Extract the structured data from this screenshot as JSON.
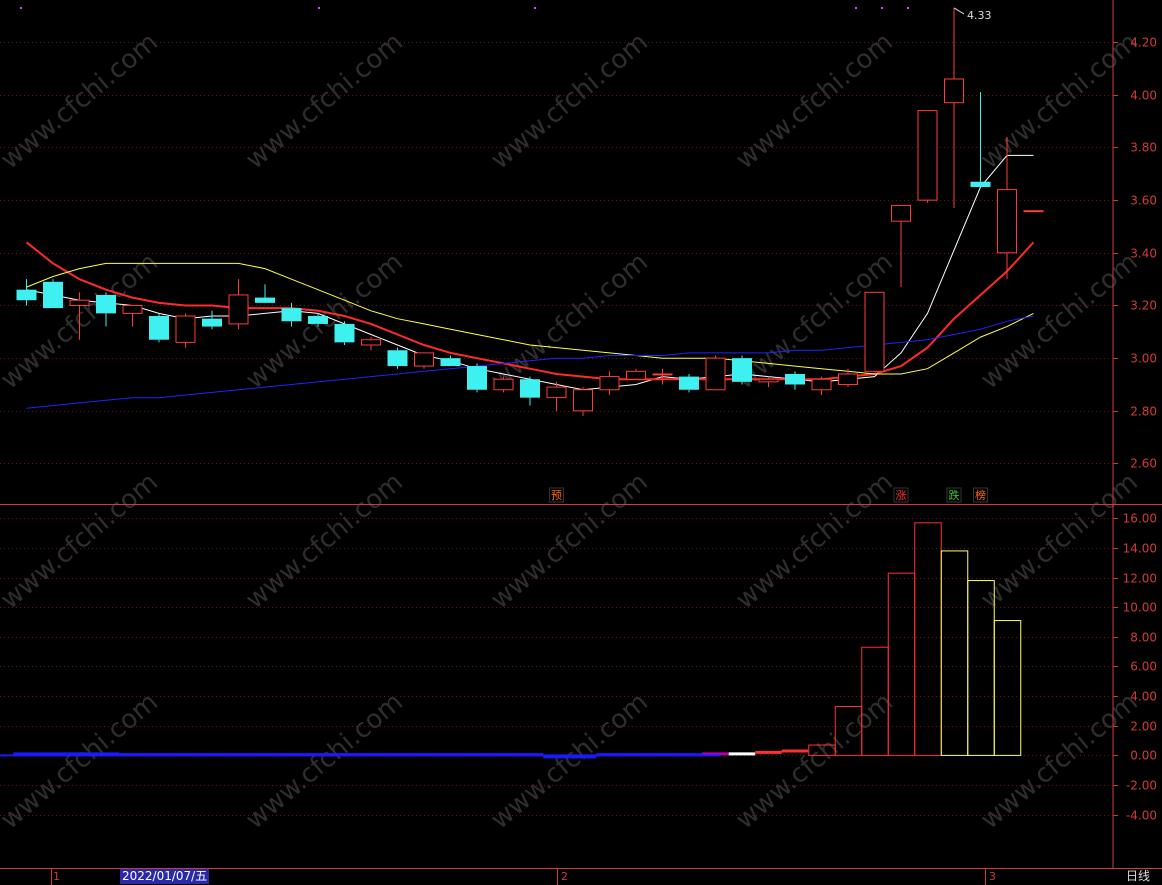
{
  "chart_data": [
    {
      "type": "candlestick",
      "panel": "price",
      "yticks": [
        "4.20",
        "4.00",
        "3.80",
        "3.60",
        "3.40",
        "3.20",
        "3.00",
        "2.80",
        "2.60"
      ],
      "ylim": [
        2.45,
        4.36
      ],
      "grid": true,
      "high_label": "4.33",
      "candles": [
        {
          "o": 3.26,
          "h": 3.3,
          "l": 3.2,
          "c": 3.22
        },
        {
          "o": 3.29,
          "h": 3.3,
          "l": 3.19,
          "c": 3.19
        },
        {
          "o": 3.2,
          "h": 3.25,
          "l": 3.07,
          "c": 3.22
        },
        {
          "o": 3.24,
          "h": 3.25,
          "l": 3.12,
          "c": 3.17
        },
        {
          "o": 3.17,
          "h": 3.2,
          "l": 3.12,
          "c": 3.2
        },
        {
          "o": 3.16,
          "h": 3.17,
          "l": 3.06,
          "c": 3.07
        },
        {
          "o": 3.06,
          "h": 3.17,
          "l": 3.04,
          "c": 3.16
        },
        {
          "o": 3.15,
          "h": 3.18,
          "l": 3.11,
          "c": 3.12
        },
        {
          "o": 3.13,
          "h": 3.3,
          "l": 3.11,
          "c": 3.24
        },
        {
          "o": 3.23,
          "h": 3.28,
          "l": 3.21,
          "c": 3.21
        },
        {
          "o": 3.19,
          "h": 3.21,
          "l": 3.12,
          "c": 3.14
        },
        {
          "o": 3.16,
          "h": 3.17,
          "l": 3.12,
          "c": 3.13
        },
        {
          "o": 3.13,
          "h": 3.14,
          "l": 3.05,
          "c": 3.06
        },
        {
          "o": 3.05,
          "h": 3.08,
          "l": 3.03,
          "c": 3.07
        },
        {
          "o": 3.03,
          "h": 3.04,
          "l": 2.96,
          "c": 2.97
        },
        {
          "o": 2.97,
          "h": 3.02,
          "l": 2.96,
          "c": 3.02
        },
        {
          "o": 3.0,
          "h": 3.01,
          "l": 2.97,
          "c": 2.97
        },
        {
          "o": 2.97,
          "h": 2.98,
          "l": 2.87,
          "c": 2.88
        },
        {
          "o": 2.88,
          "h": 2.93,
          "l": 2.87,
          "c": 2.92
        },
        {
          "o": 2.92,
          "h": 2.93,
          "l": 2.82,
          "c": 2.85
        },
        {
          "o": 2.85,
          "h": 2.91,
          "l": 2.8,
          "c": 2.89
        },
        {
          "o": 2.8,
          "h": 2.89,
          "l": 2.78,
          "c": 2.88
        },
        {
          "o": 2.88,
          "h": 2.95,
          "l": 2.86,
          "c": 2.93
        },
        {
          "o": 2.92,
          "h": 2.96,
          "l": 2.92,
          "c": 2.95
        },
        {
          "o": 2.94,
          "h": 2.96,
          "l": 2.9,
          "c": 2.94
        },
        {
          "o": 2.93,
          "h": 2.94,
          "l": 2.87,
          "c": 2.88
        },
        {
          "o": 2.88,
          "h": 3.01,
          "l": 2.88,
          "c": 3.0
        },
        {
          "o": 3.0,
          "h": 3.01,
          "l": 2.9,
          "c": 2.91
        },
        {
          "o": 2.91,
          "h": 2.93,
          "l": 2.89,
          "c": 2.92
        },
        {
          "o": 2.94,
          "h": 2.95,
          "l": 2.88,
          "c": 2.9
        },
        {
          "o": 2.88,
          "h": 2.93,
          "l": 2.86,
          "c": 2.92
        },
        {
          "o": 2.9,
          "h": 2.96,
          "l": 2.89,
          "c": 2.94
        },
        {
          "o": 2.95,
          "h": 3.25,
          "l": 2.95,
          "c": 3.25
        },
        {
          "o": 3.52,
          "h": 3.58,
          "l": 3.27,
          "c": 3.58
        },
        {
          "o": 3.6,
          "h": 3.94,
          "l": 3.59,
          "c": 3.94
        },
        {
          "o": 3.97,
          "h": 4.33,
          "l": 3.57,
          "c": 4.06
        },
        {
          "o": 3.67,
          "h": 4.01,
          "l": 3.65,
          "c": 3.65
        },
        {
          "o": 3.4,
          "h": 3.84,
          "l": 3.3,
          "c": 3.64
        },
        {
          "o": 3.56,
          "h": 3.56,
          "l": 3.56,
          "c": 3.56
        }
      ],
      "series": [
        {
          "color": "#ffffff",
          "values": [
            3.26,
            3.24,
            3.22,
            3.21,
            3.2,
            3.17,
            3.15,
            3.16,
            3.16,
            3.17,
            3.18,
            3.17,
            3.13,
            3.09,
            3.05,
            3.01,
            2.99,
            2.96,
            2.94,
            2.92,
            2.9,
            2.88,
            2.89,
            2.9,
            2.93,
            2.92,
            2.93,
            2.94,
            2.93,
            2.92,
            2.91,
            2.92,
            2.93,
            3.02,
            3.17,
            3.41,
            3.65,
            3.77,
            3.77
          ]
        },
        {
          "color": "#ff2a2a",
          "values": [
            3.44,
            3.36,
            3.3,
            3.26,
            3.23,
            3.21,
            3.2,
            3.2,
            3.19,
            3.19,
            3.19,
            3.18,
            3.16,
            3.13,
            3.09,
            3.05,
            3.02,
            3.0,
            2.98,
            2.96,
            2.94,
            2.93,
            2.92,
            2.92,
            2.92,
            2.92,
            2.92,
            2.92,
            2.92,
            2.92,
            2.92,
            2.93,
            2.94,
            2.97,
            3.04,
            3.15,
            3.24,
            3.33,
            3.44
          ]
        },
        {
          "color": "#ffff40",
          "values": [
            3.27,
            3.31,
            3.34,
            3.36,
            3.36,
            3.36,
            3.36,
            3.36,
            3.36,
            3.34,
            3.3,
            3.26,
            3.22,
            3.18,
            3.15,
            3.13,
            3.11,
            3.09,
            3.07,
            3.05,
            3.04,
            3.03,
            3.02,
            3.01,
            3.0,
            3.0,
            3.0,
            2.99,
            2.98,
            2.97,
            2.96,
            2.95,
            2.94,
            2.94,
            2.96,
            3.02,
            3.08,
            3.12,
            3.17
          ]
        },
        {
          "color": "#2222ff",
          "values": [
            2.81,
            2.82,
            2.83,
            2.84,
            2.85,
            2.85,
            2.86,
            2.87,
            2.88,
            2.89,
            2.9,
            2.91,
            2.92,
            2.93,
            2.94,
            2.95,
            2.96,
            2.97,
            2.98,
            2.99,
            3.0,
            3.0,
            3.01,
            3.01,
            3.01,
            3.02,
            3.02,
            3.02,
            3.02,
            3.03,
            3.03,
            3.04,
            3.05,
            3.06,
            3.07,
            3.09,
            3.11,
            3.14,
            3.16
          ]
        }
      ],
      "signals": [
        {
          "index": 20,
          "label": "预",
          "color": "#ff6a00"
        },
        {
          "index": 33,
          "label": "涨",
          "color": "#ff3030"
        },
        {
          "index": 35,
          "label": "跌",
          "color": "#32cd32"
        },
        {
          "index": 36,
          "label": "榜",
          "color": "#ff6a00"
        }
      ]
    },
    {
      "type": "bar",
      "panel": "indicator",
      "yticks": [
        "16.00",
        "14.00",
        "12.00",
        "10.00",
        "8.00",
        "6.00",
        "4.00",
        "2.00",
        "0.00",
        "-2.00",
        "-4.00"
      ],
      "ylim": [
        -7.6,
        16.9
      ],
      "grid": true,
      "values": [
        0.1,
        0.1,
        0.1,
        0.1,
        0.05,
        0.05,
        0.05,
        0.05,
        0.05,
        0.05,
        0.05,
        0.05,
        0.05,
        0.05,
        0.05,
        0.05,
        0.05,
        0.05,
        0.05,
        0.05,
        -0.1,
        -0.1,
        0.05,
        0.05,
        0.05,
        0.05,
        0.1,
        0.1,
        0.2,
        0.3,
        0.7,
        3.3,
        7.3,
        12.3,
        15.7,
        13.8,
        11.8,
        9.1
      ],
      "colors": [
        "#1a1aff",
        "#1a1aff",
        "#1a1aff",
        "#1a1aff",
        "#1a1aff",
        "#1a1aff",
        "#1a1aff",
        "#1a1aff",
        "#1a1aff",
        "#1a1aff",
        "#1a1aff",
        "#1a1aff",
        "#1a1aff",
        "#1a1aff",
        "#1a1aff",
        "#1a1aff",
        "#1a1aff",
        "#1a1aff",
        "#1a1aff",
        "#1a1aff",
        "#1a1aff",
        "#1a1aff",
        "#1a1aff",
        "#1a1aff",
        "#1a1aff",
        "#1a1aff",
        "#b000b0",
        "#ffffff",
        "#ff3030",
        "#ff3030",
        "#ff3030",
        "#ff3030",
        "#ff3030",
        "#ff3030",
        "#ff3030",
        "#ffff66",
        "#ffff66",
        "#ffff66"
      ]
    }
  ],
  "footer": {
    "month_labels": [
      "1",
      "2",
      "3"
    ],
    "cursor_date": "2022/01/07/五",
    "period": "日线"
  },
  "watermark": "www.cfchi.com"
}
